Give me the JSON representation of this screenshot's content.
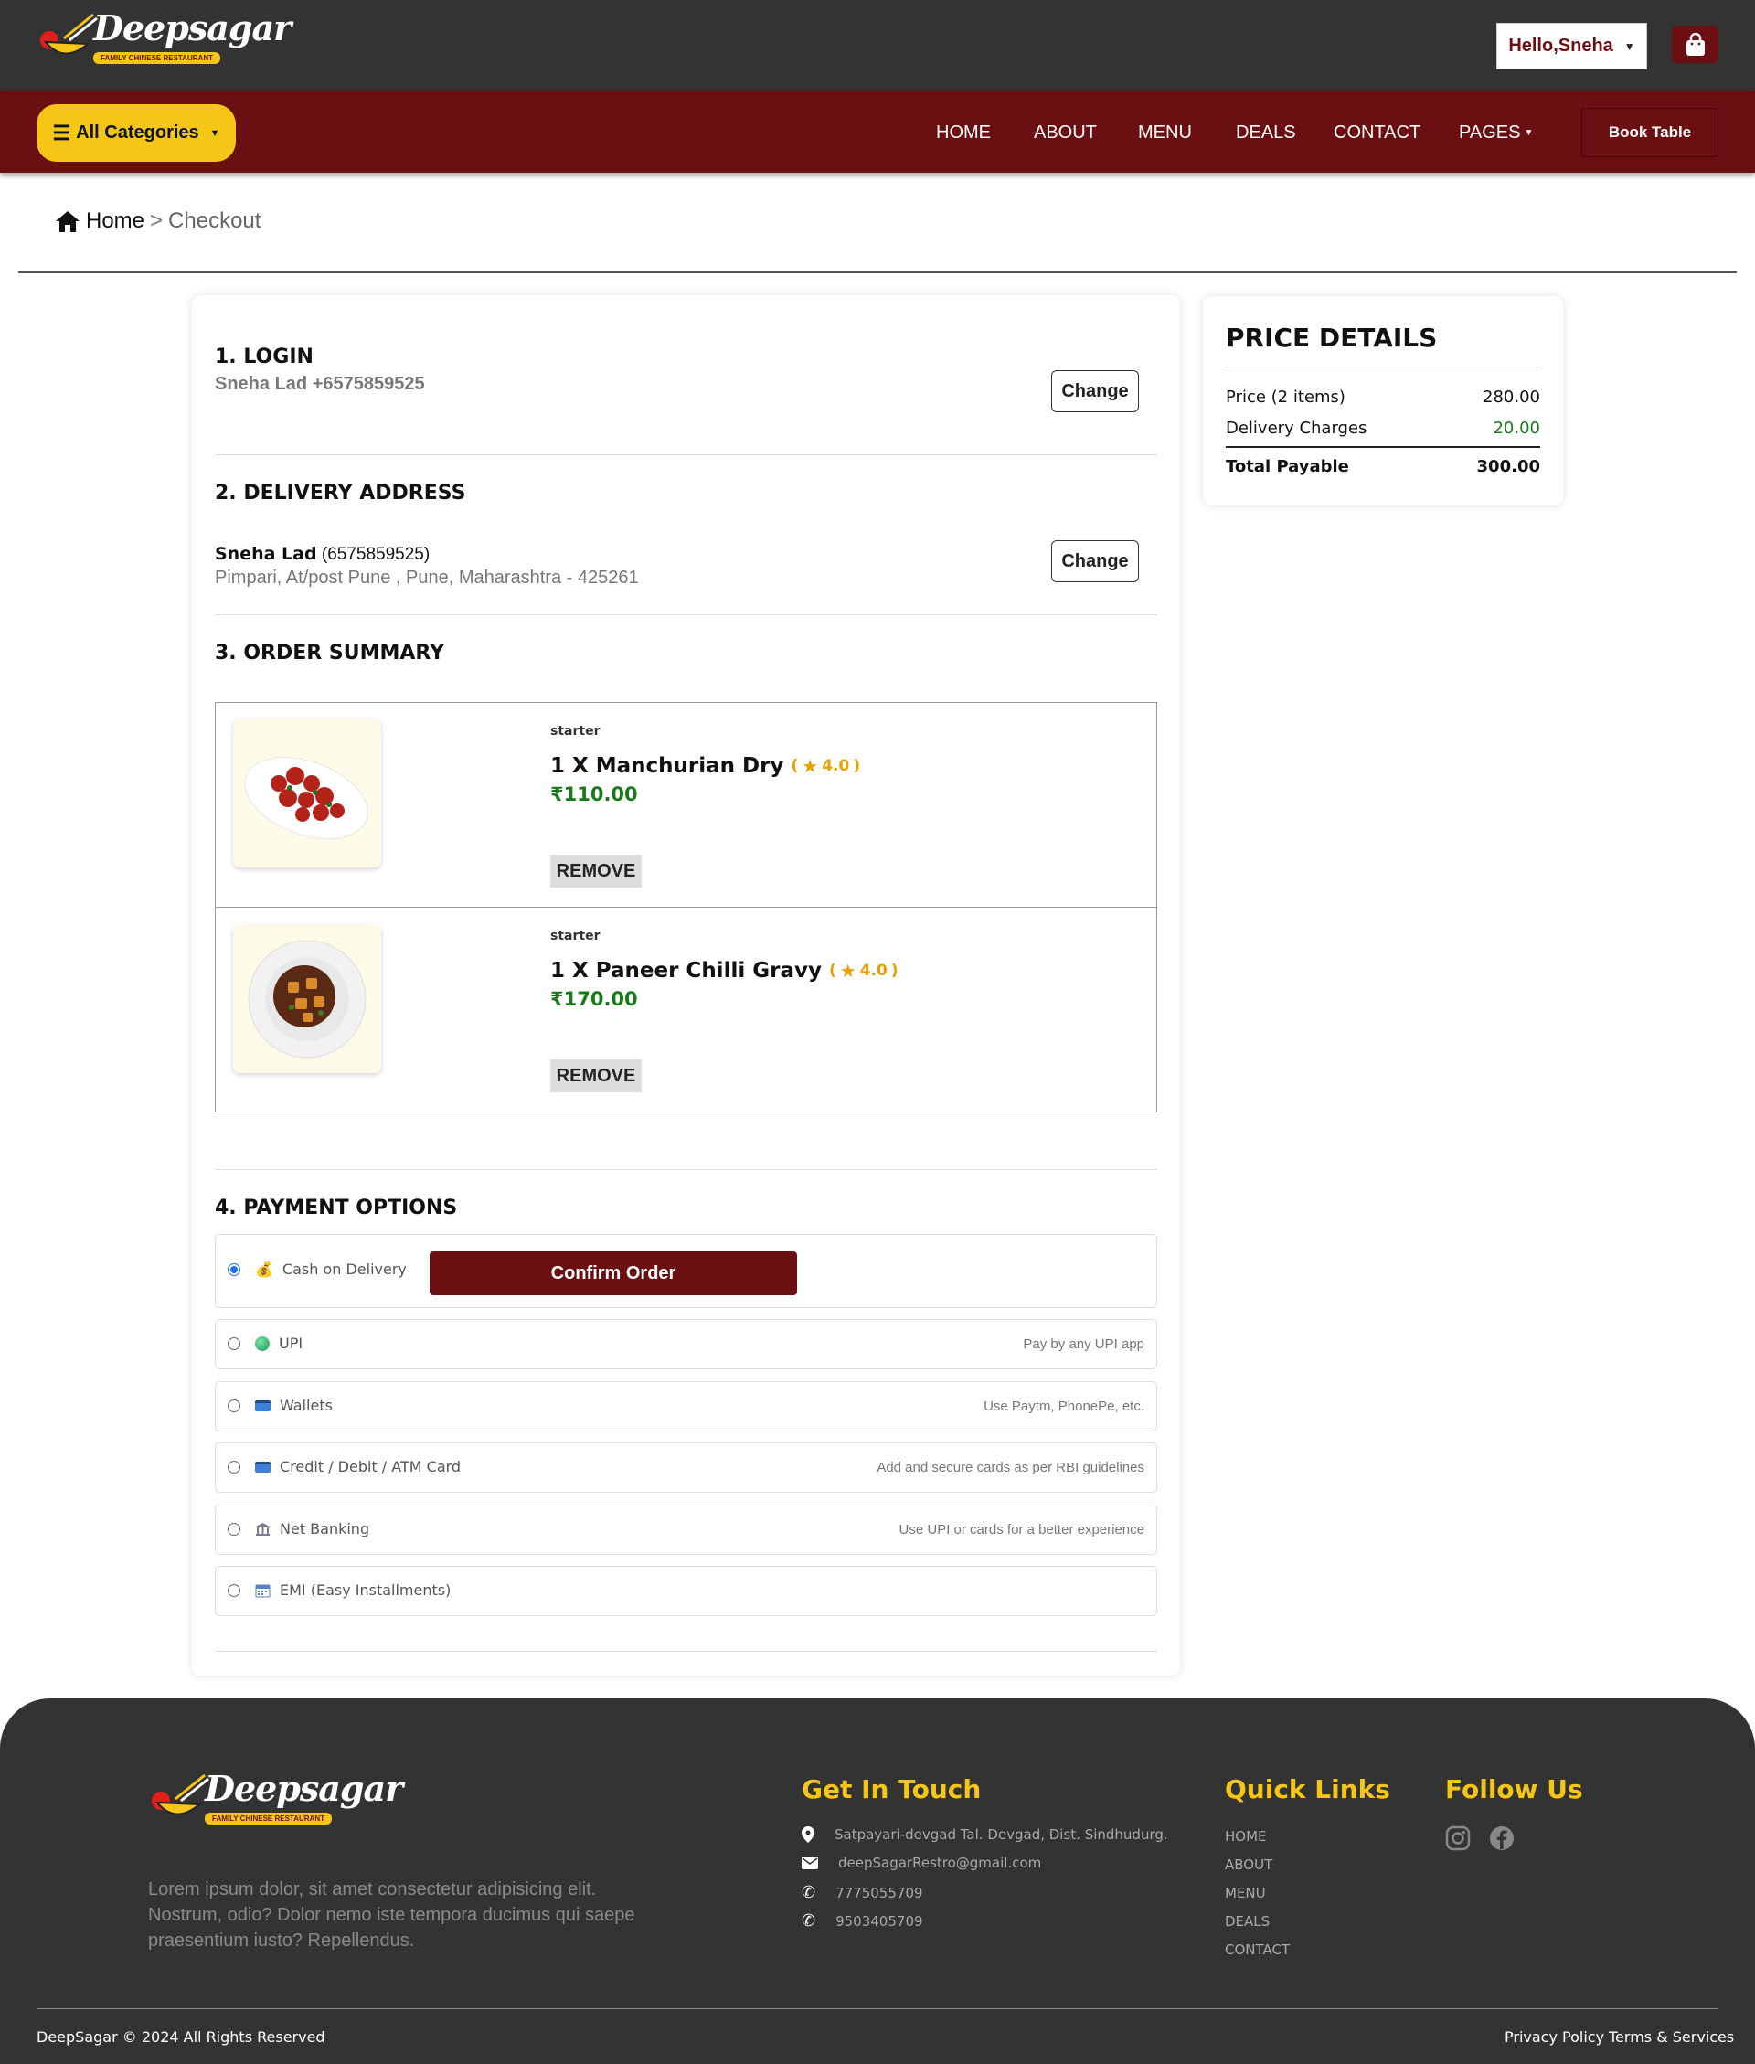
{
  "brand": {
    "name": "Deepsagar",
    "tagline": "FAMILY CHINESE RESTAURANT"
  },
  "header": {
    "greeting": "Hello,Sneha"
  },
  "nav": {
    "all_categories": "All Categories",
    "links": [
      "HOME",
      "ABOUT",
      "MENU",
      "DEALS",
      "CONTACT",
      "PAGES"
    ],
    "book_table": "Book Table"
  },
  "breadcrumb": {
    "home": "Home",
    "separator": ">",
    "current": "Checkout"
  },
  "login": {
    "title": "1. LOGIN",
    "user": "Sneha Lad +6575859525",
    "change": "Change"
  },
  "address": {
    "title": "2. DELIVERY ADDRESS",
    "name": "Sneha Lad",
    "phone": "(6575859525)",
    "line": "Pimpari, At/post Pune , Pune, Maharashtra - 425261",
    "change": "Change"
  },
  "order_summary": {
    "title": "3. ORDER SUMMARY",
    "items": [
      {
        "category": "starter",
        "name": "1 X Manchurian Dry",
        "rating": "4.0",
        "price": "₹110.00",
        "remove": "REMOVE"
      },
      {
        "category": "starter",
        "name": "1 X Paneer Chilli Gravy",
        "rating": "4.0",
        "price": "₹170.00",
        "remove": "REMOVE"
      }
    ]
  },
  "payment": {
    "title": "4. PAYMENT OPTIONS",
    "confirm": "Confirm Order",
    "options": [
      {
        "label": "Cash on Delivery",
        "hint": "",
        "icon": "money-bag-icon",
        "selected": true
      },
      {
        "label": "UPI",
        "hint": "Pay by any UPI app",
        "icon": "upi-icon",
        "selected": false
      },
      {
        "label": "Wallets",
        "hint": "Use Paytm, PhonePe, etc.",
        "icon": "wallet-card-icon",
        "selected": false
      },
      {
        "label": "Credit / Debit / ATM Card",
        "hint": "Add and secure cards as per RBI guidelines",
        "icon": "credit-card-icon",
        "selected": false
      },
      {
        "label": "Net Banking",
        "hint": "Use UPI or cards for a better experience",
        "icon": "bank-icon",
        "selected": false
      },
      {
        "label": "EMI (Easy Installments)",
        "hint": "",
        "icon": "calendar-icon",
        "selected": false
      }
    ]
  },
  "price_details": {
    "title": "PRICE DETAILS",
    "price_label": "Price (2 items)",
    "price_value": "280.00",
    "delivery_label": "Delivery Charges",
    "delivery_value": "20.00",
    "total_label": "Total Payable",
    "total_value": "300.00",
    "accent_green": "#1a7a1a"
  },
  "footer": {
    "about": "Lorem ipsum dolor, sit amet consectetur adipisicing elit. Nostrum, odio? Dolor nemo iste tempora ducimus qui saepe praesentium iusto? Repellendus.",
    "contact_title": "Get In Touch",
    "address": "Satpayari-devgad Tal. Devgad, Dist. Sindhudurg.",
    "email": "deepSagarRestro@gmail.com",
    "phone1": "7775055709",
    "phone2": "9503405709",
    "links_title": "Quick Links",
    "links": [
      "HOME",
      "ABOUT",
      "MENU",
      "DEALS",
      "CONTACT"
    ],
    "follow_title": "Follow Us",
    "copyright": "DeepSagar © 2024 All Rights Reserved",
    "privacy": "Privacy Policy",
    "terms": "Terms & Services"
  },
  "colors": {
    "maroon": "#6b0f13",
    "yellow": "#f5c518",
    "dark": "#333333"
  }
}
